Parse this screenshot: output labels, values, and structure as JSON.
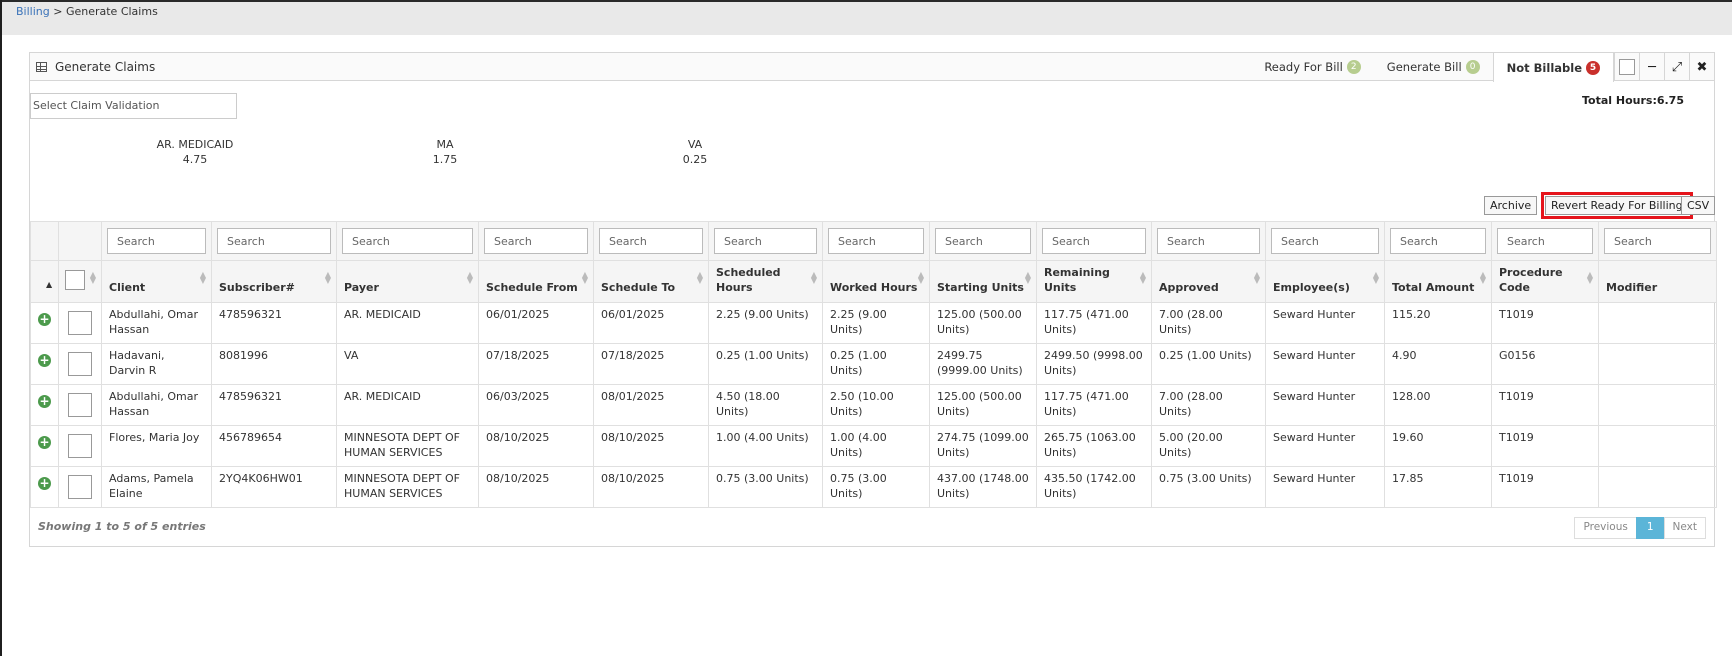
{
  "breadcrumb": {
    "parent": "Billing",
    "separator": " > ",
    "current": "Generate Claims"
  },
  "panel": {
    "title": "Generate Claims"
  },
  "tabs": [
    {
      "label": "Ready For Bill",
      "count": "2",
      "color": "#b7cd8f"
    },
    {
      "label": "Generate Bill",
      "count": "0",
      "color": "#b7cd8f"
    },
    {
      "label": "Not Billable",
      "count": "5",
      "color": "#c9302c"
    }
  ],
  "header_buttons": {
    "minimize": "─",
    "expand": "⤢",
    "close": "✖"
  },
  "claim_validation": {
    "placeholder": "Select Claim Validation"
  },
  "total_hours": "Total Hours:6.75",
  "summary": [
    {
      "payer": "AR. MEDICAID",
      "hours": "4.75"
    },
    {
      "payer": "MA",
      "hours": "1.75"
    },
    {
      "payer": "VA",
      "hours": "0.25"
    }
  ],
  "actions": {
    "archive": "Archive",
    "revert": "Revert Ready For Billing",
    "csv": "CSV"
  },
  "search_placeholder": "Search",
  "columns": [
    "Client",
    "Subscriber#",
    "Payer",
    "Schedule From",
    "Schedule To",
    "Scheduled Hours",
    "Worked Hours",
    "Starting Units",
    "Remaining Units",
    "Approved",
    "Employee(s)",
    "Total Amount",
    "Procedure Code",
    "Modifier"
  ],
  "rows": [
    [
      "Abdullahi, Omar Hassan",
      "478596321",
      "AR. MEDICAID",
      "06/01/2025",
      "06/01/2025",
      "2.25 (9.00 Units)",
      "2.25 (9.00 Units)",
      "125.00 (500.00 Units)",
      "117.75 (471.00 Units)",
      "7.00 (28.00 Units)",
      "Seward Hunter",
      "115.20",
      "T1019",
      ""
    ],
    [
      "Hadavani, Darvin R",
      "8081996",
      "VA",
      "07/18/2025",
      "07/18/2025",
      "0.25 (1.00 Units)",
      "0.25 (1.00 Units)",
      "2499.75 (9999.00 Units)",
      "2499.50 (9998.00 Units)",
      "0.25 (1.00 Units)",
      "Seward Hunter",
      "4.90",
      "G0156",
      ""
    ],
    [
      "Abdullahi, Omar Hassan",
      "478596321",
      "AR. MEDICAID",
      "06/03/2025",
      "08/01/2025",
      "4.50 (18.00 Units)",
      "2.50 (10.00 Units)",
      "125.00 (500.00 Units)",
      "117.75 (471.00 Units)",
      "7.00 (28.00 Units)",
      "Seward Hunter",
      "128.00",
      "T1019",
      ""
    ],
    [
      "Flores, Maria Joy",
      "456789654",
      "MINNESOTA DEPT OF HUMAN SERVICES",
      "08/10/2025",
      "08/10/2025",
      "1.00 (4.00 Units)",
      "1.00 (4.00 Units)",
      "274.75 (1099.00 Units)",
      "265.75 (1063.00 Units)",
      "5.00 (20.00 Units)",
      "Seward Hunter",
      "19.60",
      "T1019",
      ""
    ],
    [
      "Adams, Pamela Elaine",
      "2YQ4K06HW01",
      "MINNESOTA DEPT OF HUMAN SERVICES",
      "08/10/2025",
      "08/10/2025",
      "0.75 (3.00 Units)",
      "0.75 (3.00 Units)",
      "437.00 (1748.00 Units)",
      "435.50 (1742.00 Units)",
      "0.75 (3.00 Units)",
      "Seward Hunter",
      "17.85",
      "T1019",
      ""
    ]
  ],
  "footer": {
    "info": "Showing 1 to 5 of 5 entries",
    "previous": "Previous",
    "page": "1",
    "next": "Next"
  }
}
